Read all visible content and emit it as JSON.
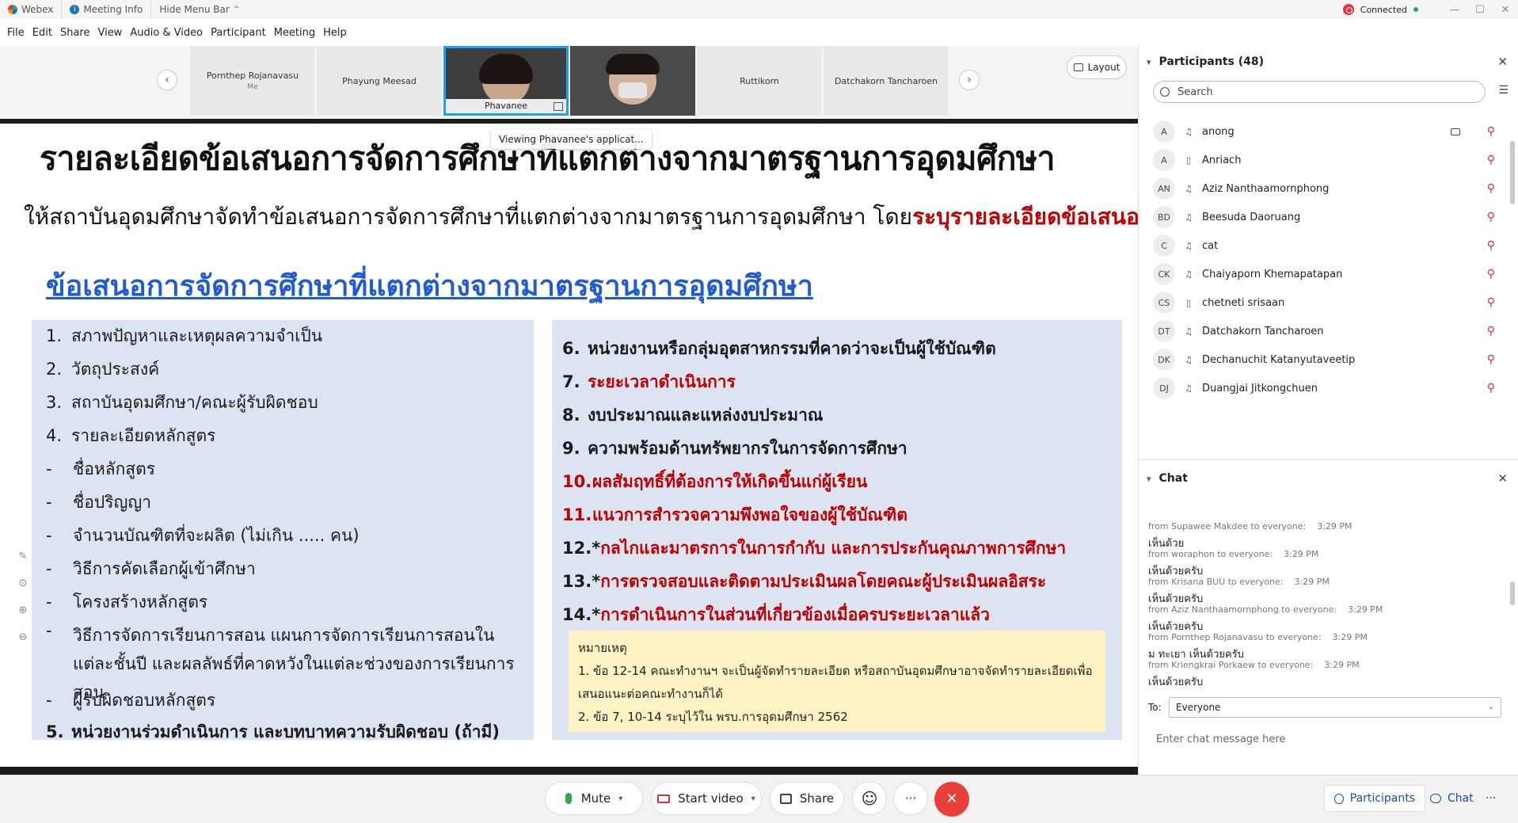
{
  "titlebar": {
    "app_name": "Webex",
    "meeting_info": "Meeting Info",
    "hide_menu": "Hide Menu Bar",
    "hide_menu_chevron": "^",
    "status": "Connected",
    "min": "—",
    "max": "☐",
    "close": "✕"
  },
  "menu": [
    "File",
    "Edit",
    "Share",
    "View",
    "Audio & Video",
    "Participant",
    "Meeting",
    "Help"
  ],
  "video_strip": {
    "prev_arrow": "‹",
    "next_arrow": "›",
    "tiles": [
      {
        "name": "Pornthep Rojanavasu",
        "sub": "Me"
      },
      {
        "name": "Phayung Meesad",
        "sub": ""
      },
      {
        "name": "Phavanee",
        "sub": ""
      },
      {
        "name": "",
        "sub": ""
      },
      {
        "name": "Ruttikorn",
        "sub": ""
      },
      {
        "name": "Datchakorn Tancharoen",
        "sub": ""
      }
    ],
    "layout_label": "Layout"
  },
  "slide": {
    "viewing_badge": "Viewing Phavanee's applicat...",
    "title": "รายละเอียดข้อเสนอการจัดการศึกษาที่แตกต่างจากมาตรฐานการอุดมศึกษา",
    "subtitle_plain": "ให้สถาบันอุดมศึกษาจัดทำข้อเสนอการจัดการศึกษาที่แตกต่างจากมาตรฐานการอุดมศึกษา โดย",
    "subtitle_red": "ระบุรายละเอียดข้อเสนอฯ ดังนี้",
    "heading": "ข้อเสนอการจัดการศึกษาที่แตกต่างจากมาตรฐานการอุดมศึกษา",
    "left_items": [
      {
        "num": "1.",
        "text": "สภาพปัญหาและเหตุผลความจำเป็น"
      },
      {
        "num": "2.",
        "text": "วัตถุประสงค์"
      },
      {
        "num": "3.",
        "text": "สถาบันอุดมศึกษา/คณะผู้รับผิดชอบ"
      },
      {
        "num": "4.",
        "text": "รายละเอียดหลักสูตร"
      },
      {
        "num": "-",
        "text": "ชื่อหลักสูตร"
      },
      {
        "num": "-",
        "text": "ชื่อปริญญา"
      },
      {
        "num": "-",
        "text": "จำนวนบัณฑิตที่จะผลิต (ไม่เกิน ..... คน)"
      },
      {
        "num": "-",
        "text": "วิธีการคัดเลือกผู้เข้าศึกษา"
      },
      {
        "num": "-",
        "text": "โครงสร้างหลักสูตร"
      },
      {
        "num": "-",
        "text": "วิธีการจัดการเรียนการสอน แผนการจัดการเรียนการสอนในแต่ละชั้นปี และผลลัพธ์ที่คาดหวังในแต่ละช่วงของการเรียนการสอน"
      },
      {
        "num": "-",
        "text": "ผู้รับผิดชอบหลักสูตร"
      },
      {
        "num": "5.",
        "text": "หน่วยงานร่วมดำเนินการ และบทบาทความรับผิดชอบ (ถ้ามี)"
      }
    ],
    "right_items": [
      {
        "num": "6.",
        "text": "หน่วยงานหรือกลุ่มอุตสาหกรรมที่คาดว่าจะเป็นผู้ใช้บัณฑิต"
      },
      {
        "num": "7.",
        "text": "ระยะเวลาดำเนินการ"
      },
      {
        "num": "8.",
        "text": "งบประมาณและแหล่งงบประมาณ"
      },
      {
        "num": "9.",
        "text": "ความพร้อมด้านทรัพยากรในการจัดการศึกษา"
      },
      {
        "num": "10.",
        "text": "ผลสัมฤทธิ์ที่ต้องการให้เกิดขึ้นแก่ผู้เรียน"
      },
      {
        "num": "11.",
        "text": "แนวการสำรวจความพึงพอใจของผู้ใช้บัณฑิต"
      },
      {
        "num": "12.*",
        "text": "กลไกและมาตรการในการกำกับ และการประกันคุณภาพการศึกษา"
      },
      {
        "num": "13.*",
        "text": "การตรวจสอบและติดตามประเมินผลโดยคณะผู้ประเมินผลอิสระ"
      },
      {
        "num": "14.*",
        "text": "การดำเนินการในส่วนที่เกี่ยวข้องเมื่อครบระยะเวลาแล้ว"
      }
    ],
    "note_title": "หมายเหตุ",
    "note_line1": "1. ข้อ 12-14 คณะทำงานฯ จะเป็นผู้จัดทำรายละเอียด หรือสถาบันอุดมศึกษาอาจจัดทำรายละเอียดเพื่อเสนอแนะต่อคณะทำงานก็ได้",
    "note_line2": "2. ข้อ 7, 10-14 ระบุไว้ใน พรบ.การอุดมศึกษา 2562"
  },
  "participants": {
    "header": "Participants (48)",
    "close": "✕",
    "search_placeholder": "Search",
    "list": [
      {
        "initials": "A",
        "name": "anong",
        "device": "headset",
        "video": true
      },
      {
        "initials": "A",
        "name": "Anriach",
        "device": "phone",
        "video": false
      },
      {
        "initials": "AN",
        "name": "Aziz Nanthaamornphong",
        "device": "headset",
        "video": false
      },
      {
        "initials": "BD",
        "name": "Beesuda Daoruang",
        "device": "headset",
        "video": false
      },
      {
        "initials": "C",
        "name": "cat",
        "device": "headset",
        "video": false
      },
      {
        "initials": "CK",
        "name": "Chaiyaporn Khemapatapan",
        "device": "headset",
        "video": false
      },
      {
        "initials": "CS",
        "name": "chetneti srisaan",
        "device": "phone",
        "video": false
      },
      {
        "initials": "DT",
        "name": "Datchakorn Tancharoen",
        "device": "headset",
        "video": false
      },
      {
        "initials": "DK",
        "name": "Dechanuchit Katanyutaveetip",
        "device": "headset",
        "video": false
      },
      {
        "initials": "DJ",
        "name": "Duangjai Jitkongchuen",
        "device": "headset",
        "video": false
      }
    ]
  },
  "chat": {
    "header": "Chat",
    "close": "✕",
    "messages": [
      {
        "from": "from Supawee Makdee to everyone:",
        "time": "3:29 PM",
        "body": "เห็นด้วย"
      },
      {
        "from": "from woraphon to everyone:",
        "time": "3:29 PM",
        "body": "เห็นด้วยครับ"
      },
      {
        "from": "from Krisana BUU to everyone:",
        "time": "3:29 PM",
        "body": "เห็นด้วยครับ"
      },
      {
        "from": "from Aziz Nanthaamornphong to everyone:",
        "time": "3:29 PM",
        "body": "เห็นด้วยครับ"
      },
      {
        "from": "from Pornthep Rojanavasu to everyone:",
        "time": "3:29 PM",
        "body": "ม ทะเยา เห็นด้วยครับ"
      },
      {
        "from": "from Kriengkrai Porkaew to everyone:",
        "time": "3:29 PM",
        "body": "เห็นด้วยครับ"
      }
    ],
    "to_label": "To:",
    "to_value": "Everyone",
    "input_placeholder": "Enter chat message here"
  },
  "controls": {
    "mute": "Mute",
    "start_video": "Start video",
    "share": "Share",
    "reactions": "☺",
    "more": "···",
    "end": "✕",
    "participants": "Participants",
    "chat": "Chat",
    "more_right": "···"
  },
  "colors": {
    "accent_blue": "#1da1f2",
    "slide_red": "#c00000",
    "slide_link": "#1f5bd6",
    "slide_box": "#dce4f2",
    "note_bg": "#fff2c4",
    "end_red": "#e8403a",
    "muted_mic": "#d9302d",
    "connected_green": "#2bab4c"
  }
}
